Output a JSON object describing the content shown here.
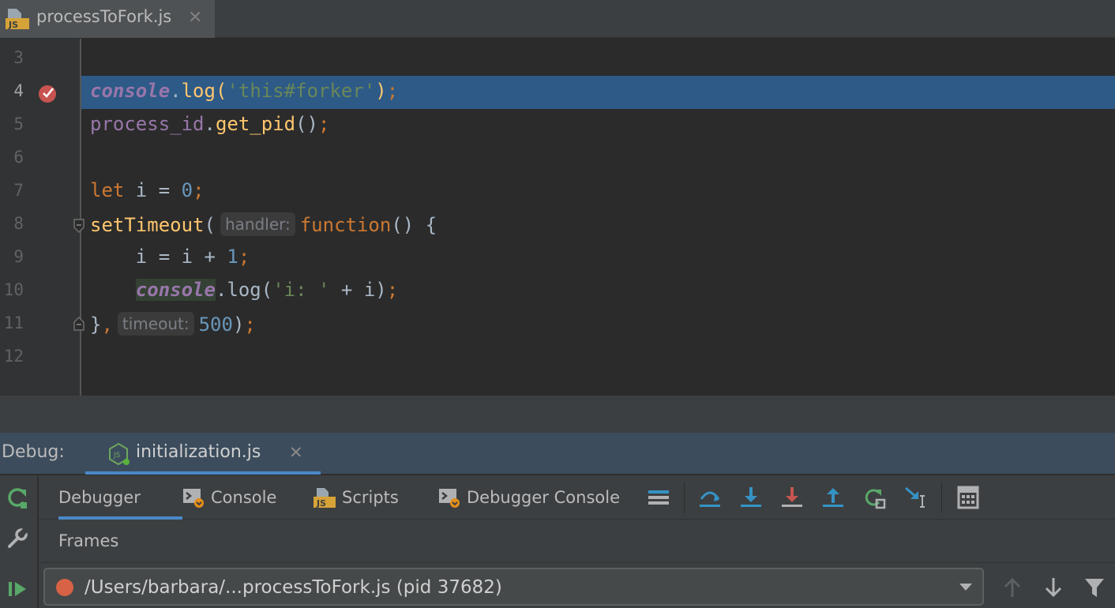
{
  "editor_tab": {
    "filename": "processToFork.js",
    "icon": "js-file-icon",
    "close": "✕"
  },
  "editor": {
    "line_numbers": [
      "3",
      "4",
      "5",
      "6",
      "7",
      "8",
      "9",
      "10",
      "11",
      "12"
    ],
    "lines": {
      "l4": {
        "obj": "console",
        "dot": ".",
        "method": "log",
        "open": "(",
        "str": "'this#forker'",
        "close": ")",
        "semi": ";"
      },
      "l5": {
        "var": "process_id",
        "dot": ".",
        "fn": "get_pid",
        "parens": "()",
        "semi": ";"
      },
      "l7": {
        "kw": "let",
        "rest": " i = ",
        "num": "0",
        "semi": ";"
      },
      "l8": {
        "fn": "setTimeout",
        "open": "(",
        "hint": "handler:",
        "kw": "function",
        "rest": "() {"
      },
      "l9": {
        "indent": "    ",
        "rest": "i = i + ",
        "num": "1",
        "semi": ";"
      },
      "l10": {
        "indent": "    ",
        "obj": "console",
        "dot": ".",
        "method": "log",
        "open": "(",
        "str": "'i: '",
        "rest": " + i)",
        "semi": ";"
      },
      "l11": {
        "brace": "}",
        "comma": ",",
        "hint": "timeout:",
        "num": "500",
        "close": ")",
        "semi": ";"
      }
    }
  },
  "debug": {
    "label": "Debug:",
    "session_tab": "initialization.js",
    "session_close": "✕",
    "tabs": [
      {
        "label": "Debugger",
        "icon": ""
      },
      {
        "label": "Console",
        "icon": "console-icon"
      },
      {
        "label": "Scripts",
        "icon": "js-scripts-icon"
      },
      {
        "label": "Debugger Console",
        "icon": "debugger-console-icon"
      }
    ],
    "frames_label": "Frames",
    "thread_value": "/Users/barbara/...processToFork.js (pid 37682)"
  },
  "colors": {
    "accent": "#4a88c7",
    "line_highlight": "#2d5a87",
    "breakpoint": "#c75450",
    "keyword": "#cc7832",
    "function": "#ffc66d",
    "number": "#6897bb",
    "string": "#6a8759",
    "object": "#9876aa"
  }
}
